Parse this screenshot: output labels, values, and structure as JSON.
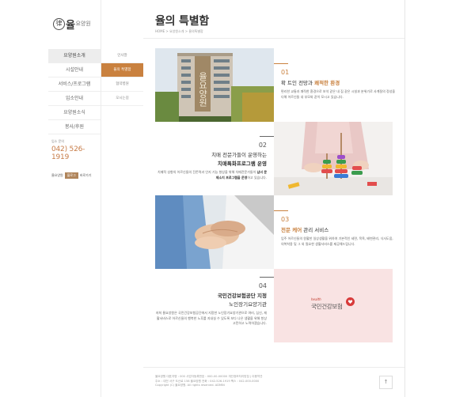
{
  "logo": {
    "mark": "律",
    "name": "율",
    "sub": "요양원"
  },
  "nav": {
    "items": [
      {
        "label": "요양원소개",
        "active": true
      },
      {
        "label": "시설안내",
        "active": false
      },
      {
        "label": "서비스/프로그램",
        "active": false
      },
      {
        "label": "입소안내",
        "active": false
      },
      {
        "label": "요양원소식",
        "active": false
      },
      {
        "label": "봉사/후원",
        "active": false
      }
    ]
  },
  "contact": {
    "label": "입소 문의",
    "phone": "042) 526-1919",
    "blog_prefix": "율요양원",
    "blog_tag": "블로그",
    "blog_suffix": "바로가기"
  },
  "subnav": {
    "items": [
      {
        "label": "인사말",
        "active": false
      },
      {
        "label": "율의 특별함",
        "active": true
      },
      {
        "label": "협약병원",
        "active": false
      },
      {
        "label": "오시는길",
        "active": false
      }
    ]
  },
  "header": {
    "title": "율의 특별함",
    "breadcrumb": "HOME > 요양원소개 > 율의특별함"
  },
  "features": [
    {
      "num": "01",
      "head_pre": "확 트인 전망과 ",
      "head_hl": "쾌적한 환경",
      "head_post": "",
      "desc": "편리한 교통과 쾌적한 환경으로 보석 같은 내 집 같은 시설과 분위기로 사계절의 정성을 다해 어르신들 내 부모와 같이 모시고 있습니다."
    },
    {
      "num": "02",
      "head1": "치매 전문가들이 운영하는",
      "head2": "치매특화프로그램 운영",
      "desc_pre": "치매적 성향의 어르신들의 잔존력과 인지 기능 향상을 위해 치매전문가들이 ",
      "desc_b": "남녀 문제소지 프로그램을 운영",
      "desc_post": "하고 있습니다."
    },
    {
      "num": "03",
      "head_hl": "전문 케어",
      "head_post": " 관리 서비스",
      "desc": "입주 어르신들의 원활한 일상생활을 위하여 기본적인 세면, 목욕, 배변관리, 식사도움, 의복착용 및 그 외 필요한 생활서비스를 제공해드립니다."
    },
    {
      "num": "04",
      "head1": "국민건강보험공단 지정",
      "head2": "노인장기요양기관",
      "desc": "저희 율요양원은 국민건강보험공단에서 지정한 노인장기요양기관으로 여러, 심신, 재활서비스로 어르신들의 행복한 노후를 지내실 수 있도록 보다 나은 생활을 위해 항상 고민하고 노력하겠습니다."
    }
  ],
  "insurance_logo": {
    "health": "health",
    "name": "국민건강보험"
  },
  "building_sign": "율요양원",
  "footer": {
    "line1": "율요양원  대표자명 : 000  사업자등록번호 : 000-00-00000  개인정보처리방침  |  이용약관",
    "line2": "주소 : 대전 서구 도산로 158 율요양원  전화 : 042-526-1919  팩스 : 042-000-0000",
    "line3": "Copyright (C) 율요양원. All rights reserved.  ADMIN",
    "top_label": "↑"
  },
  "colors": {
    "accent": "#c9813f",
    "nav_active": "#ededed",
    "pink_panel": "#f9e3e3"
  }
}
